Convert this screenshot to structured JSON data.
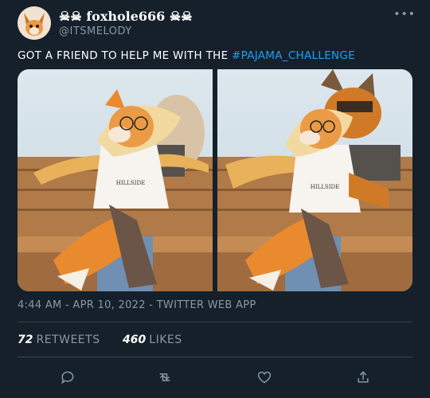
{
  "tweet": {
    "author": {
      "display_name": "☠☠ foxhole666 ☠☠",
      "handle": "@ITSMELODY"
    },
    "more_label": "•••",
    "text": {
      "prefix": "GOT A FRIEND TO HELP ME WITH THE ",
      "hashtag": "#PAJAMA_CHALLENGE"
    },
    "timestamp": "4:44 AM",
    "date": "APR 10, 2022",
    "source": "TWITTER WEB APP",
    "separator": "-",
    "stats": {
      "retweets_count": "72",
      "retweets_label": "RETWEETS",
      "likes_count": "460",
      "likes_label": "LIKES"
    },
    "media_shirt_text": "HILLSIDE"
  },
  "colors": {
    "background": "#15202b",
    "accent": "#1da1f2",
    "muted": "#8899a6",
    "divider": "#38444d"
  },
  "icons": {
    "reply": "speech-bubble-icon",
    "retweet": "retweet-arrows-icon",
    "like": "heart-icon",
    "share": "share-upload-icon",
    "more": "ellipsis-icon"
  }
}
